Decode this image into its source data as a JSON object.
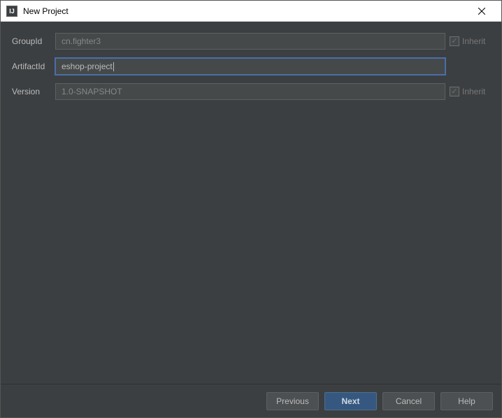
{
  "window": {
    "title": "New Project",
    "app_icon_text": "IJ"
  },
  "form": {
    "groupid": {
      "label": "GroupId",
      "value": "cn.fighter3",
      "inherit_label": "Inherit",
      "inherit_checked": true
    },
    "artifactid": {
      "label": "ArtifactId",
      "value": "eshop-project"
    },
    "version": {
      "label": "Version",
      "value": "1.0-SNAPSHOT",
      "inherit_label": "Inherit",
      "inherit_checked": true
    }
  },
  "buttons": {
    "previous": "Previous",
    "next": "Next",
    "cancel": "Cancel",
    "help": "Help"
  }
}
